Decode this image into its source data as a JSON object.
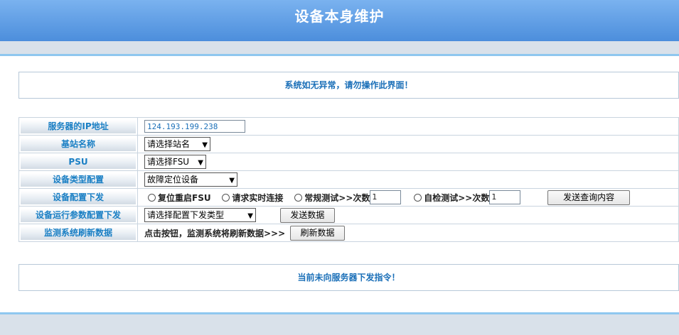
{
  "header": {
    "title": "设备本身维护"
  },
  "notice_top": "系统如无异常，请勿操作此界面！",
  "notice_bottom": "当前未向服务器下发指令！",
  "form": {
    "server_ip": {
      "label": "服务器的IP地址",
      "value": "124.193.199.238"
    },
    "station_name": {
      "label": "基站名称",
      "selected": "请选择站名"
    },
    "psu": {
      "label": "PSU",
      "selected": "请选择FSU"
    },
    "device_type": {
      "label": "设备类型配置",
      "selected": "故障定位设备"
    },
    "device_config": {
      "label": "设备配置下发",
      "options": {
        "reset": "复位重启FSU",
        "realtime": "请求实时连接",
        "regular": "常规测试>>次数",
        "selfcheck": "自检测试>>次数"
      },
      "regular_count": "1",
      "selfcheck_count": "1",
      "send_button": "发送查询内容"
    },
    "run_params": {
      "label": "设备运行参数配置下发",
      "selected": "请选择配置下发类型",
      "send_button": "发送数据"
    },
    "refresh": {
      "label": "监测系统刷新数据",
      "hint": "点击按钮，监测系统将刷新数据>>>",
      "button": "刷新数据"
    }
  }
}
